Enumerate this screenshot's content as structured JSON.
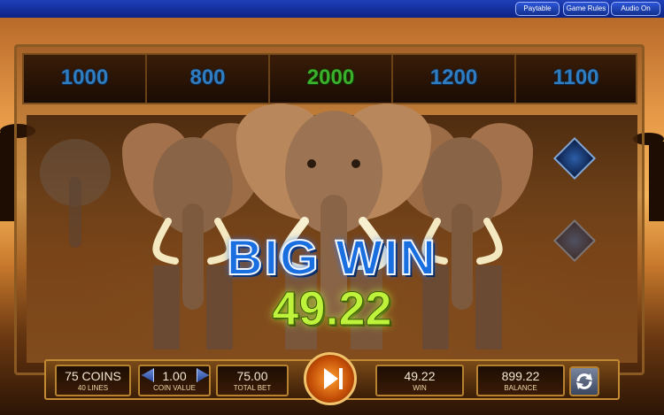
{
  "top_menu": {
    "paytable": "Paytable",
    "game_rules": "Game Rules",
    "audio": "Audio On"
  },
  "jackpots": [
    {
      "value": "1000"
    },
    {
      "value": "800"
    },
    {
      "value": "2000"
    },
    {
      "value": "1200"
    },
    {
      "value": "1100"
    }
  ],
  "win": {
    "title": "BIG WIN",
    "amount": "49.22"
  },
  "controls": {
    "coins": {
      "value": "75 COINS",
      "label": "40 LINES"
    },
    "coin_value": {
      "value": "1.00",
      "label": "COIN VALUE"
    },
    "total_bet": {
      "value": "75.00",
      "label": "TOTAL BET"
    },
    "win": {
      "value": "49.22",
      "label": "WIN"
    },
    "balance": {
      "value": "899.22",
      "label": "BALANCE"
    }
  },
  "icons": {
    "spin": "play-icon",
    "autoplay": "refresh-icon",
    "decrease": "triangle-left-icon",
    "increase": "triangle-right-icon"
  },
  "colors": {
    "top_bar": "#0c2384",
    "jackpot_blue": "#2f7dc0",
    "jackpot_green": "#3bb02a",
    "big_win_blue": "#1a6fe0",
    "win_amount_green": "#bff23a",
    "panel_gold": "#c38a34"
  }
}
